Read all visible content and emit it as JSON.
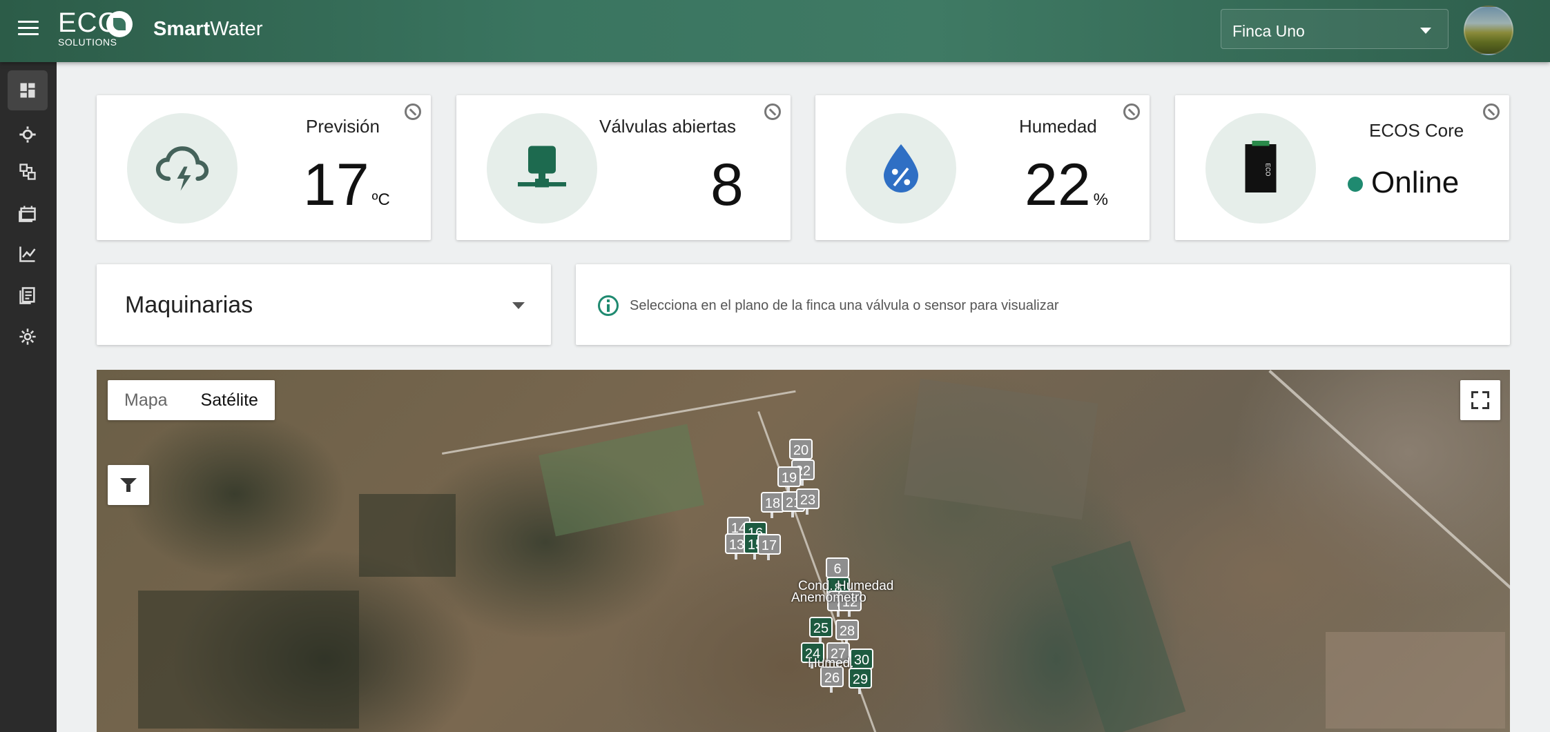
{
  "header": {
    "logo_top": "ECO",
    "logo_bottom": "SOLUTIONS",
    "app_name_bold": "Smart",
    "app_name_rest": "Water",
    "farm_selected": "Finca Uno"
  },
  "sidebar": {
    "items": [
      {
        "icon": "dashboard-icon"
      },
      {
        "icon": "sensor-icon"
      },
      {
        "icon": "valves-icon"
      },
      {
        "icon": "calendar-icon"
      },
      {
        "icon": "chart-icon"
      },
      {
        "icon": "report-icon"
      },
      {
        "icon": "settings-icon"
      }
    ]
  },
  "kpis": {
    "forecast": {
      "title": "Previsión",
      "value": "17",
      "unit": "ºC"
    },
    "valves": {
      "title": "Válvulas abiertas",
      "value": "8"
    },
    "humidity": {
      "title": "Humedad",
      "value": "22",
      "unit": "%"
    },
    "core": {
      "title": "ECOS Core",
      "status": "Online",
      "device_label": "ECO"
    }
  },
  "machinery": {
    "label": "Maquinarias"
  },
  "info_message": "Selecciona en el plano de la finca una válvula o sensor para visualizar",
  "map": {
    "toggle_map": "Mapa",
    "toggle_satellite": "Satélite",
    "markers": [
      {
        "label": "20",
        "color": "gray"
      },
      {
        "label": "22",
        "color": "gray"
      },
      {
        "label": "19",
        "color": "gray"
      },
      {
        "label": "18",
        "color": "gray"
      },
      {
        "label": "21",
        "color": "gray"
      },
      {
        "label": "23",
        "color": "gray"
      },
      {
        "label": "14",
        "color": "gray"
      },
      {
        "label": "16",
        "color": "green"
      },
      {
        "label": "13",
        "color": "gray"
      },
      {
        "label": "15",
        "color": "green"
      },
      {
        "label": "17",
        "color": "gray"
      },
      {
        "label": "6",
        "color": "gray"
      },
      {
        "label": "8",
        "color": "green"
      },
      {
        "label": "7",
        "color": "gray"
      },
      {
        "label": "12",
        "color": "gray"
      },
      {
        "label": "25",
        "color": "green"
      },
      {
        "label": "28",
        "color": "gray"
      },
      {
        "label": "24",
        "color": "green"
      },
      {
        "label": "27",
        "color": "gray"
      },
      {
        "label": "30",
        "color": "green"
      },
      {
        "label": "26",
        "color": "gray"
      },
      {
        "label": "29",
        "color": "green"
      }
    ],
    "labels": {
      "label1": "Cond. Humedad",
      "label2": "Anemómetro",
      "label3": "Humed."
    }
  },
  "colors": {
    "accent": "#1f8a70",
    "header": "#3a7560",
    "sidebar": "#2b2b2b",
    "valve_active": "#1d5b40"
  }
}
